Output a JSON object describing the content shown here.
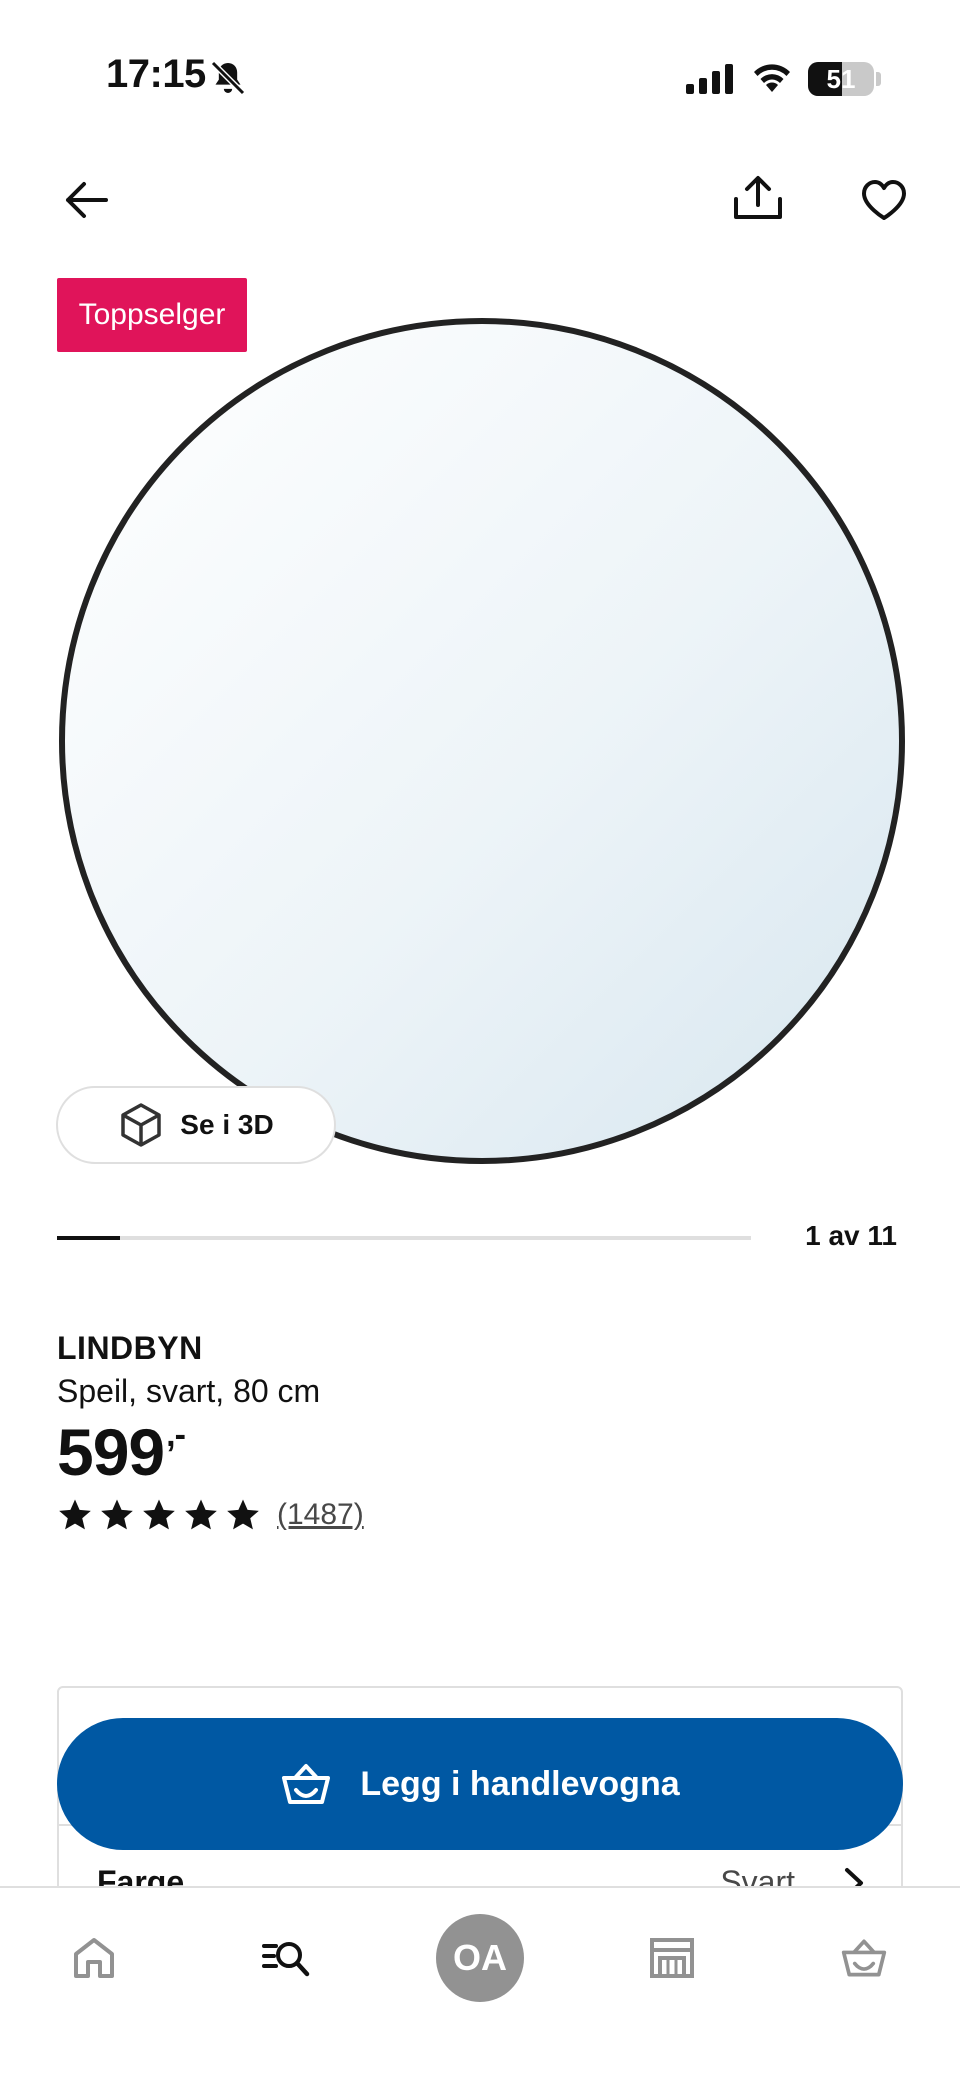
{
  "status_bar": {
    "time": "17:15",
    "battery_level": "51",
    "battery_fraction": 0.51
  },
  "top_nav": {
    "back_icon": "arrow-left-icon",
    "share_icon": "share-icon",
    "favourite_icon": "heart-icon"
  },
  "gallery": {
    "badge": "Toppselger",
    "view_3d_label": "Se i 3D",
    "counter": "1 av 11",
    "current_image": 1,
    "total_images": 11
  },
  "product": {
    "name": "LINDBYN",
    "description": "Speil, svart, 80 cm",
    "price": "599",
    "price_suffix": ",-",
    "rating_stars": 5,
    "review_count": "(1487)"
  },
  "options": {
    "color_label": "Farge",
    "color_value": "Svart"
  },
  "cart_button": {
    "label": "Legg i handlevogna",
    "icon": "shopping-basket-icon"
  },
  "tab_bar": {
    "avatar_initials": "OA",
    "tabs": [
      "home-icon",
      "search-icon",
      "profile-avatar",
      "store-icon",
      "basket-icon"
    ]
  },
  "colors": {
    "badge": "#e0145a",
    "primary_button": "#0058a3",
    "avatar": "#929292"
  }
}
